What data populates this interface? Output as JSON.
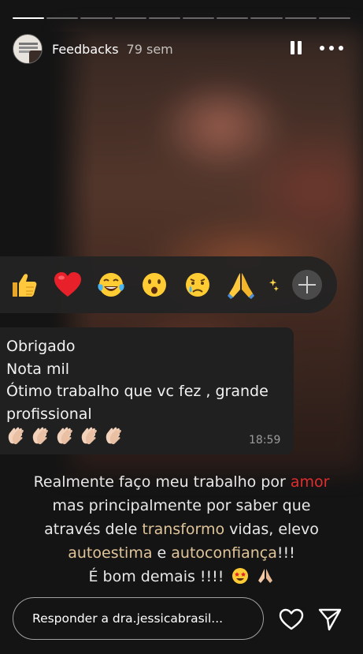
{
  "progress": {
    "segments": 10,
    "current_segment_fill": 1.0,
    "completed_segments": 1
  },
  "header": {
    "username": "Feedbacks",
    "time_ago": "79 sem"
  },
  "reactions": [
    "thumbs-up-icon",
    "red-heart-icon",
    "tears-of-joy-icon",
    "surprised-face-icon",
    "crying-face-icon",
    "folded-hands-icon",
    "sparkles-icon"
  ],
  "message": {
    "lines": [
      "Obrigado",
      "Nota mil",
      "Ótimo trabalho que vc fez , grande",
      "profissional"
    ],
    "clap_count": 5,
    "time": "18:59"
  },
  "caption": {
    "l1_a": "Realmente faço meu trabalho por ",
    "l1_b": "amor",
    "l2": "mas principalmente por saber que",
    "l3_a": "através dele ",
    "l3_b": "transformo",
    "l3_c": " vidas, elevo",
    "l4_a": "autoestima",
    "l4_b": " e ",
    "l4_c": "autoconfiança",
    "l4_d": "!!!",
    "l5": "É bom demais !!!!"
  },
  "reply": {
    "placeholder": "Responder a dra.jessicabrasil..."
  },
  "colors": {
    "highlight_red": "#e02e2e",
    "highlight_gold": "#e0c49a"
  }
}
